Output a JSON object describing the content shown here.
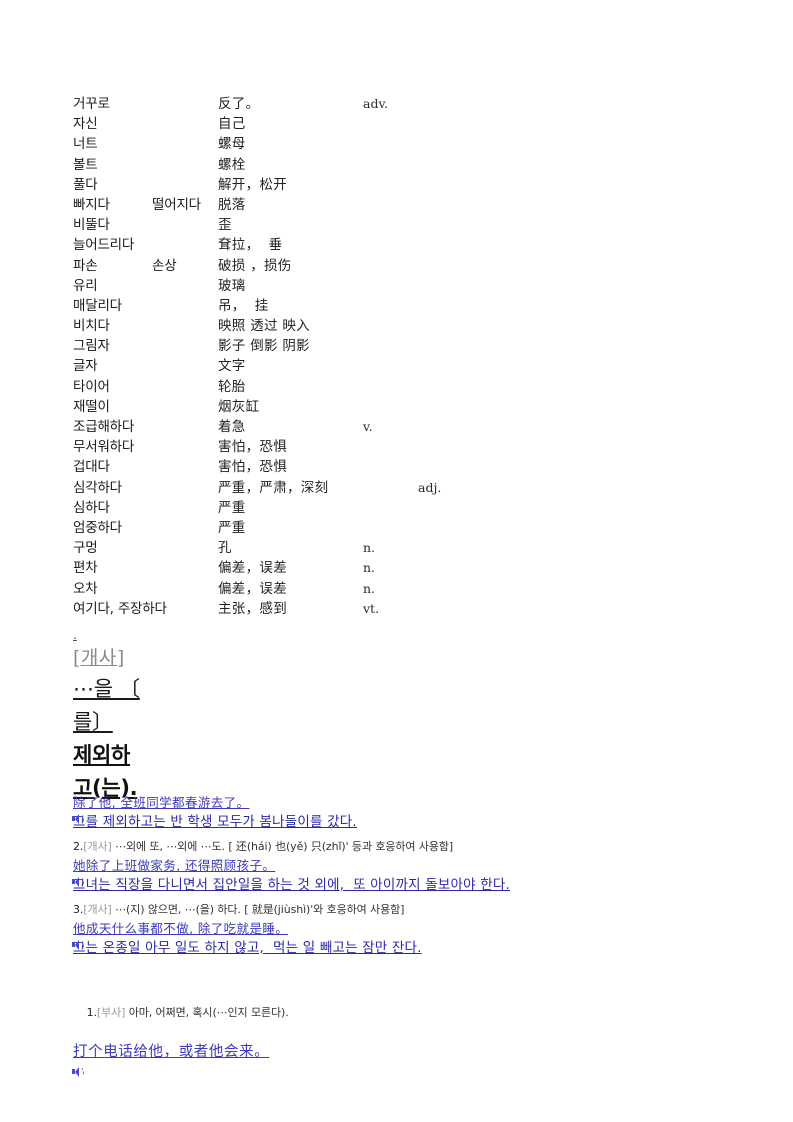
{
  "page": {
    "background": "#ffffff",
    "text_color": "#000000",
    "example_zh_color": "#3b3bbe",
    "example_ko_color": "#2a2aa8",
    "pos_label_color": "#8a8a8a"
  },
  "vocabulary": {
    "rows": [
      {
        "korean": "거꾸로",
        "korean2": "",
        "chinese": "反了。",
        "pos": "adv."
      },
      {
        "korean": "자신",
        "korean2": "",
        "chinese": "自己",
        "pos": ""
      },
      {
        "korean": "너트",
        "korean2": "",
        "chinese": "螺母",
        "pos": ""
      },
      {
        "korean": "볼트",
        "korean2": "",
        "chinese": "螺栓",
        "pos": ""
      },
      {
        "korean": "풀다",
        "korean2": "",
        "chinese": "解开，松开",
        "pos": ""
      },
      {
        "korean": "빠지다",
        "korean2": "떨어지다",
        "chinese": "脱落",
        "pos": ""
      },
      {
        "korean": "비뚤다",
        "korean2": "",
        "chinese": "歪",
        "pos": ""
      },
      {
        "korean": "늘어드리다",
        "korean2": "",
        "chinese": "耷拉，  垂",
        "pos": ""
      },
      {
        "korean": "파손",
        "korean2": "손상",
        "chinese": "破损 ，损伤",
        "pos": ""
      },
      {
        "korean": "유리",
        "korean2": "",
        "chinese": "玻璃",
        "pos": ""
      },
      {
        "korean": "매달리다",
        "korean2": "",
        "chinese": "吊，  挂",
        "pos": ""
      },
      {
        "korean": "비치다",
        "korean2": "",
        "chinese": "映照 透过 映入",
        "pos": ""
      },
      {
        "korean": "그림자",
        "korean2": "",
        "chinese": "影子 倒影 阴影",
        "pos": ""
      },
      {
        "korean": "글자",
        "korean2": "",
        "chinese": "文字",
        "pos": ""
      },
      {
        "korean": "타이어",
        "korean2": "",
        "chinese": "轮胎",
        "pos": ""
      },
      {
        "korean": "재떨이",
        "korean2": "",
        "chinese": "烟灰缸",
        "pos": ""
      },
      {
        "korean": "조급해하다",
        "korean2": "",
        "chinese": "着急",
        "pos": "v."
      },
      {
        "korean": "무서워하다",
        "korean2": "",
        "chinese": "害怕，恐惧",
        "pos": ""
      },
      {
        "korean": "겁대다",
        "korean2": "",
        "chinese": "害怕，恐惧",
        "pos": ""
      },
      {
        "korean": "심각하다",
        "korean2": "",
        "chinese": "严重，严肃，深刻",
        "pos": "adj."
      },
      {
        "korean": "심하다",
        "korean2": "",
        "chinese": "严重",
        "pos": ""
      },
      {
        "korean": "엄중하다",
        "korean2": "",
        "chinese": "严重",
        "pos": ""
      },
      {
        "korean": "구멍",
        "korean2": "",
        "chinese": "孔",
        "pos": "n."
      },
      {
        "korean": "편차",
        "korean2": "",
        "chinese": "偏差，误差",
        "pos": "n."
      },
      {
        "korean": "오차",
        "korean2": "",
        "chinese": "偏差，误差",
        "pos": "n."
      },
      {
        "korean": "여기다, 주장하다",
        "korean2": "",
        "chinese": "主张，感到",
        "pos": "vt."
      }
    ]
  },
  "headword": {
    "dot": ".",
    "pos_label": "[개사]",
    "lines": [
      "⋯을 〔",
      "를〕",
      "제외하",
      "고(는)."
    ]
  },
  "entries": [
    {
      "example_zh": "除了他, 全班同学都春游去了。",
      "example_ko": "그를 제외하고는 반 학생 모두가 봄나들이를 갔다."
    },
    {
      "sense_num": "2.",
      "sense_pos": "[개사]",
      "sense_def": " ⋯외에 또, ⋯외에 ⋯도. [ 还(hái) 也(yě) 只(zhǐ)' 등과 호응하여 사용함]",
      "example_zh": "她除了上班做家务, 还得照顾孩子。",
      "example_ko": "그녀는 직장을 다니면서 집안일을 하는 것 외에,  또 아이까지 돌보아야 한다."
    },
    {
      "sense_num": "3.",
      "sense_pos": "[개사]",
      "sense_def": " ⋯(지) 않으면, ⋯(을) 하다. [ 就是(jiùshì)'와 호응하여 사용함]",
      "example_zh": "他成天什么事都不做, 除了吃就是睡。",
      "example_ko": "그는 온종일 아무 일도 하지 않고,  먹는 일 빼고는 잠만 잔다."
    }
  ],
  "last_entry": {
    "sense_num": "1.",
    "sense_pos": "[부사]",
    "sense_def": " 아마, 어쩌면, 혹시(⋯인지 모른다).",
    "example_zh": "打个电话给他，或者他会来。"
  },
  "icons": {
    "speaker": "speaker-icon"
  }
}
